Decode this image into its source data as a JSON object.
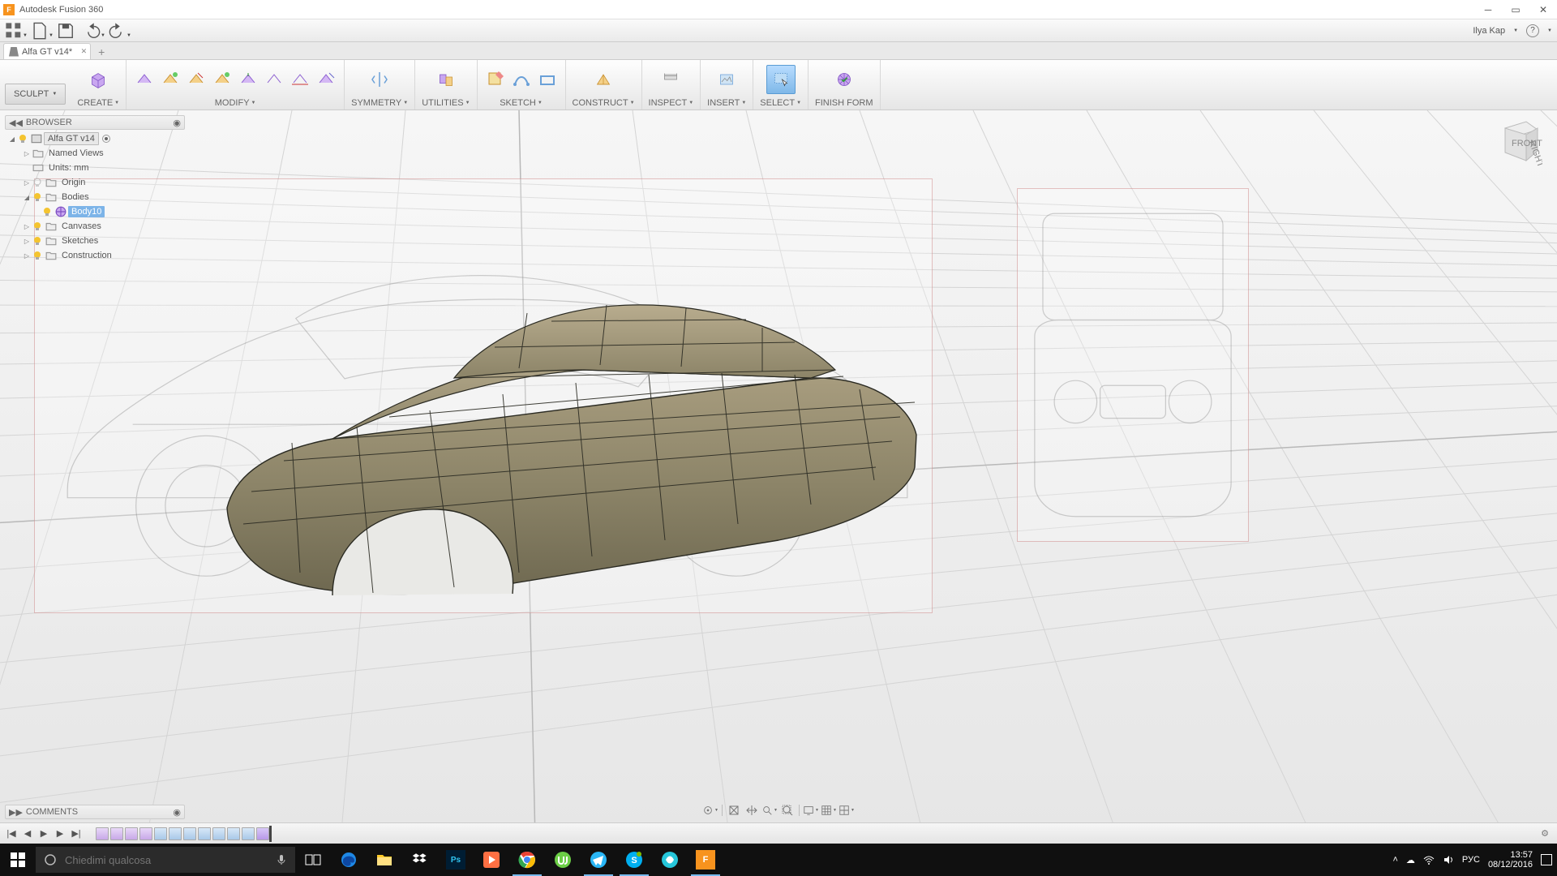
{
  "app": {
    "title": "Autodesk Fusion 360",
    "user": "Ilya Kap"
  },
  "tab": {
    "name": "Alfa GT v14*"
  },
  "ribbon": {
    "sculpt": "SCULPT",
    "create": "CREATE",
    "modify": "MODIFY",
    "symmetry": "SYMMETRY",
    "utilities": "UTILITIES",
    "sketch": "SKETCH",
    "construct": "CONSTRUCT",
    "inspect": "INSPECT",
    "insert": "INSERT",
    "select": "SELECT",
    "finish": "FINISH FORM"
  },
  "browser": {
    "title": "BROWSER",
    "root": "Alfa GT v14",
    "items": {
      "named_views": "Named Views",
      "units": "Units: mm",
      "origin": "Origin",
      "bodies": "Bodies",
      "body10": "Body10",
      "canvases": "Canvases",
      "sketches": "Sketches",
      "construction": "Construction"
    }
  },
  "comments": {
    "title": "COMMENTS"
  },
  "viewcube": {
    "front": "FRONT",
    "right": "RIGHT"
  },
  "taskbar": {
    "search_placeholder": "Chiedimi qualcosa",
    "time": "13:57",
    "date": "08/12/2016",
    "lang": "РУС"
  }
}
